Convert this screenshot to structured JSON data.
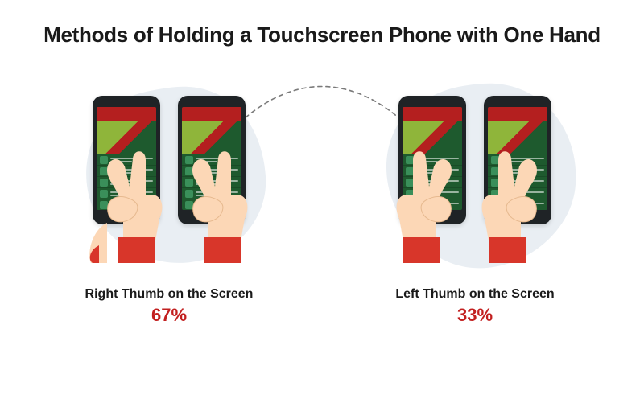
{
  "title": "Methods of Holding a Touchscreen Phone with One Hand",
  "chart_data": {
    "type": "pie",
    "title": "Methods of Holding a Touchscreen Phone with One Hand",
    "categories": [
      "Right Thumb on the Screen",
      "Left Thumb on the Screen"
    ],
    "values": [
      67,
      33
    ]
  },
  "left": {
    "label": "Right Thumb on the Screen",
    "value": "67%"
  },
  "right": {
    "label": "Left Thumb on the Screen",
    "value": "33%"
  },
  "colors": {
    "accent": "#c21f1f",
    "blob": "#e9eef3",
    "phone_body": "#1f2326",
    "sleeve": "#d8362a",
    "skin": "#fcd7b6"
  }
}
